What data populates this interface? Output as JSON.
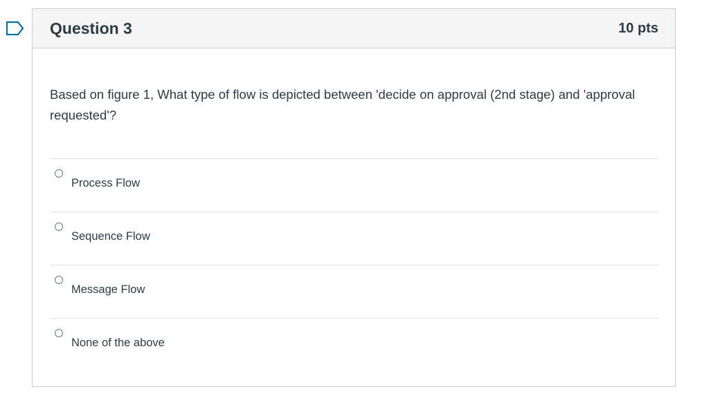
{
  "question": {
    "title": "Question 3",
    "points": "10 pts",
    "text": "Based on figure 1, What type of flow is depicted between 'decide on approval (2nd stage) and 'approval requested'?",
    "flag_icon": "bookmark-flag-icon",
    "accent_color": "#0770a3"
  },
  "answers": [
    {
      "label": "Process Flow",
      "selected": false
    },
    {
      "label": "Sequence Flow",
      "selected": false
    },
    {
      "label": "Message Flow",
      "selected": false
    },
    {
      "label": "None of the above",
      "selected": false
    }
  ]
}
